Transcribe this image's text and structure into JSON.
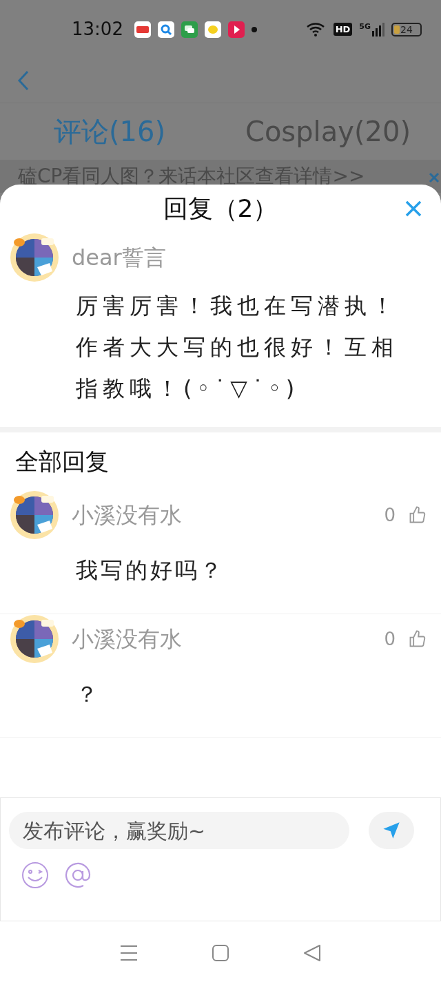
{
  "status_bar": {
    "time": "13:02",
    "hd": "HD",
    "network": "5G",
    "battery": "24"
  },
  "header": {
    "tabs": [
      {
        "label": "评论(16)",
        "selected": true
      },
      {
        "label": "Cosplay(20)",
        "selected": false
      }
    ],
    "banner": "磕CP看同人图？来话本社区查看详情>>"
  },
  "sheet": {
    "title": "回复（2）",
    "comment": {
      "author": "dear誓言",
      "text": "厉害厉害！我也在写潜执！作者大大写的也很好！互相指教哦！(◦˙▽˙◦)"
    },
    "replies_heading": "全部回复",
    "replies": [
      {
        "author": "小溪没有水",
        "likes": "0",
        "text": "我写的好吗？"
      },
      {
        "author": "小溪没有水",
        "likes": "0",
        "text": "？"
      }
    ],
    "composer": {
      "placeholder": "发布评论，赢奖励~"
    }
  }
}
